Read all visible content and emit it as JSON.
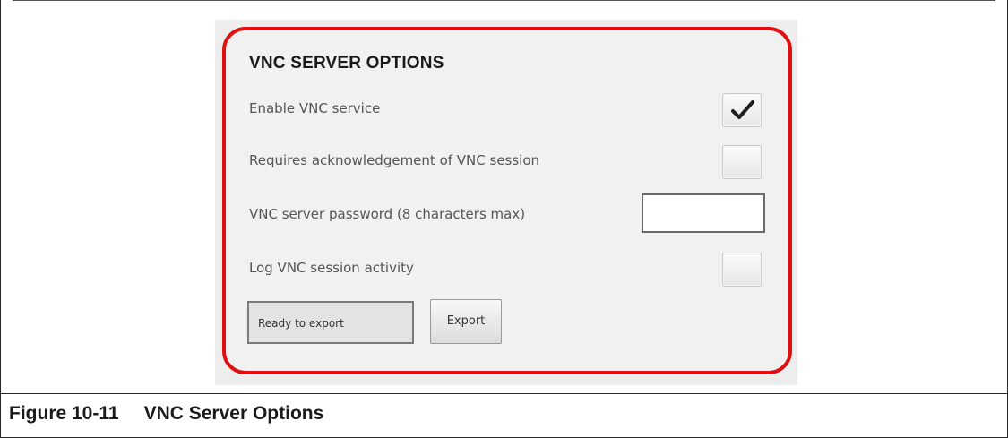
{
  "panel": {
    "title": "VNC SERVER OPTIONS",
    "highlight_color": "#e01010",
    "options": [
      {
        "label": "Enable VNC service",
        "control": "checkbox",
        "checked": true
      },
      {
        "label": "Requires acknowledgement of VNC session",
        "control": "checkbox",
        "checked": false
      },
      {
        "label": "VNC server password (8 characters max)",
        "control": "text-input",
        "value": ""
      },
      {
        "label": "Log VNC session activity",
        "control": "checkbox",
        "checked": false
      }
    ],
    "status_text": "Ready to export",
    "export_label": "Export",
    "check_icon": "checkmark-icon"
  },
  "caption": {
    "number": "Figure 10-11",
    "title": "VNC Server Options"
  }
}
